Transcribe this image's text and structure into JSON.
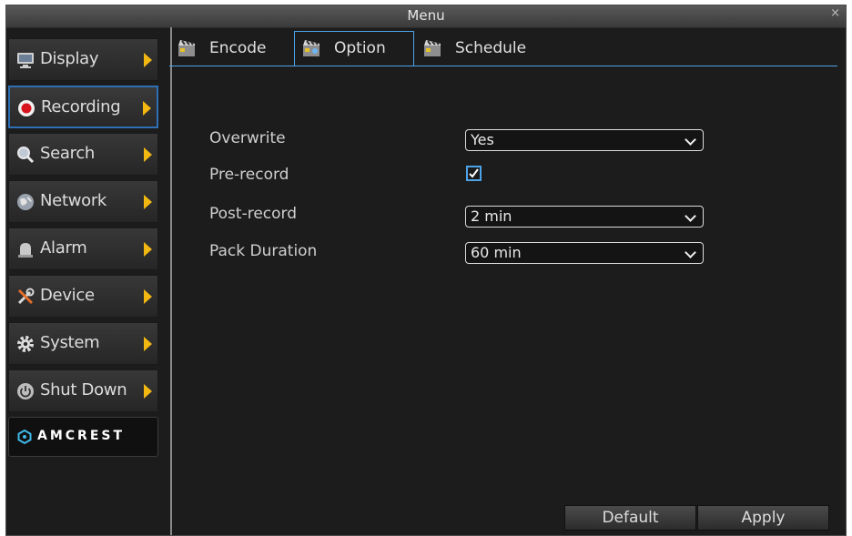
{
  "window": {
    "title": "Menu",
    "close_glyph": "×"
  },
  "sidebar": {
    "items": [
      {
        "label": "Display",
        "icon": "monitor-icon"
      },
      {
        "label": "Recording",
        "icon": "record-icon",
        "active": true
      },
      {
        "label": "Search",
        "icon": "search-icon"
      },
      {
        "label": "Network",
        "icon": "globe-icon"
      },
      {
        "label": "Alarm",
        "icon": "alarm-icon"
      },
      {
        "label": "Device",
        "icon": "tools-icon"
      },
      {
        "label": "System",
        "icon": "gear-icon"
      },
      {
        "label": "Shut Down",
        "icon": "power-icon"
      }
    ],
    "logo_text": "AMCREST"
  },
  "tabs": [
    {
      "label": "Encode",
      "icon": "clapperboard-icon"
    },
    {
      "label": "Option",
      "icon": "clapperboard-icon",
      "active": true
    },
    {
      "label": "Schedule",
      "icon": "clapperboard-icon"
    }
  ],
  "form": {
    "overwrite": {
      "label": "Overwrite",
      "value": "Yes"
    },
    "prerecord": {
      "label": "Pre-record",
      "checked": true
    },
    "postrecord": {
      "label": "Post-record",
      "value": "2 min"
    },
    "pack_duration": {
      "label": "Pack Duration",
      "value": "60 min"
    }
  },
  "buttons": {
    "default": "Default",
    "apply": "Apply"
  },
  "colors": {
    "accent": "#4da3e8",
    "arrow": "#f3b712",
    "record": "#d7141e",
    "active_border": "#2e6fb5"
  }
}
